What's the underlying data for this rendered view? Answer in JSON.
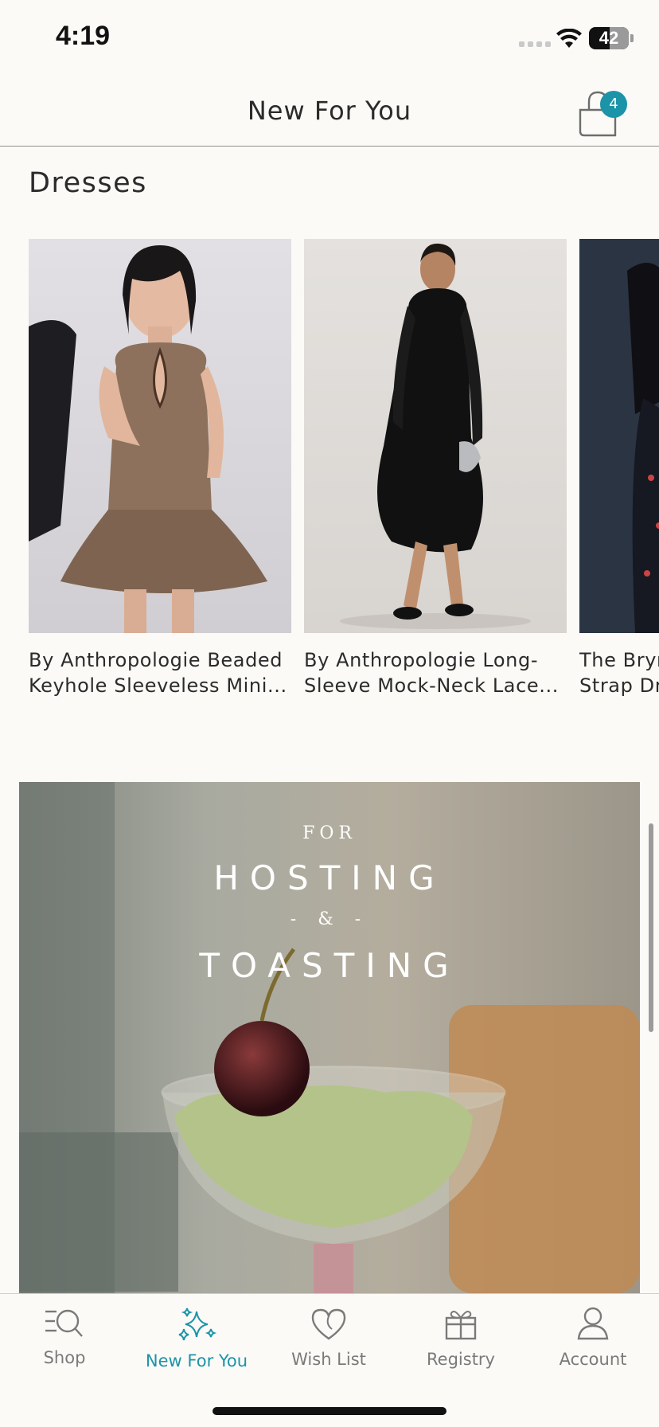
{
  "status_bar": {
    "time": "4:19",
    "battery": "42"
  },
  "header": {
    "title": "New For You",
    "cart_count": "4"
  },
  "section": {
    "title": "Dresses",
    "products": [
      {
        "line1": "By Anthropologie Beaded",
        "line2": "Keyhole Sleeveless Mini..."
      },
      {
        "line1": "By Anthropologie Long-",
        "line2": "Sleeve Mock-Neck Lace..."
      },
      {
        "line1": "The Bryn",
        "line2": "Strap Dr"
      }
    ]
  },
  "promo": {
    "line1": "FOR",
    "line2": "HOSTING",
    "line3": "- & -",
    "line4": "TOASTING"
  },
  "tabs": [
    {
      "label": "Shop",
      "icon": "search-icon"
    },
    {
      "label": "New For You",
      "icon": "sparkle-icon",
      "active": true
    },
    {
      "label": "Wish List",
      "icon": "heart-icon"
    },
    {
      "label": "Registry",
      "icon": "gift-icon"
    },
    {
      "label": "Account",
      "icon": "person-icon"
    }
  ],
  "colors": {
    "accent": "#1b94a8",
    "background": "#fbfaf7",
    "text": "#2b2b2b"
  }
}
